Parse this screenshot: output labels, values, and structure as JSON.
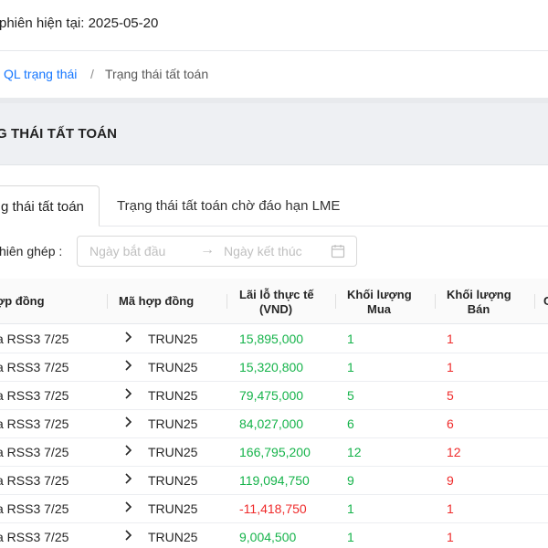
{
  "header": {
    "session_text": "phiên hiện tại: 2025-05-20"
  },
  "breadcrumb": {
    "parent": "QL trạng thái",
    "separator": "/",
    "current": "Trạng thái tất toán"
  },
  "page_title": "G THÁI TẤT TOÁN",
  "tabs": [
    {
      "label": "g thái tất toán",
      "active": true
    },
    {
      "label": "Trạng thái tất toán chờ đáo hạn LME",
      "active": false
    }
  ],
  "filter": {
    "label": "hiên ghép :",
    "start_placeholder": "Ngày bắt đầu",
    "end_placeholder": "Ngày kết thúc",
    "arrow": "→"
  },
  "table": {
    "columns": {
      "name": "ợp đồng",
      "code": "Mã hợp đồng",
      "pnl_line1": "Lãi lỗ thực tế",
      "pnl_line2": "(VND)",
      "buy_line1": "Khối lượng",
      "buy_line2": "Mua",
      "sell_line1": "Khối lượng",
      "sell_line2": "Bán",
      "extra": "C"
    },
    "rows": [
      {
        "name": "a RSS3 7/25",
        "code": "TRUN25",
        "pnl": "15,895,000",
        "buy": "1",
        "sell": "1"
      },
      {
        "name": "a RSS3 7/25",
        "code": "TRUN25",
        "pnl": "15,320,800",
        "buy": "1",
        "sell": "1"
      },
      {
        "name": "a RSS3 7/25",
        "code": "TRUN25",
        "pnl": "79,475,000",
        "buy": "5",
        "sell": "5"
      },
      {
        "name": "a RSS3 7/25",
        "code": "TRUN25",
        "pnl": "84,027,000",
        "buy": "6",
        "sell": "6"
      },
      {
        "name": "a RSS3 7/25",
        "code": "TRUN25",
        "pnl": "166,795,200",
        "buy": "12",
        "sell": "12"
      },
      {
        "name": "a RSS3 7/25",
        "code": "TRUN25",
        "pnl": "119,094,750",
        "buy": "9",
        "sell": "9"
      },
      {
        "name": "a RSS3 7/25",
        "code": "TRUN25",
        "pnl": "-11,418,750",
        "buy": "1",
        "sell": "1"
      },
      {
        "name": "a RSS3 7/25",
        "code": "TRUN25",
        "pnl": "9,004,500",
        "buy": "1",
        "sell": "1"
      }
    ]
  },
  "colors": {
    "profit": "#15b34a",
    "loss": "#ef2b2b",
    "link": "#1677ff"
  },
  "icons": {
    "expand": "chevron-right-icon",
    "calendar": "calendar-icon",
    "arrow": "arrow-right-icon"
  }
}
